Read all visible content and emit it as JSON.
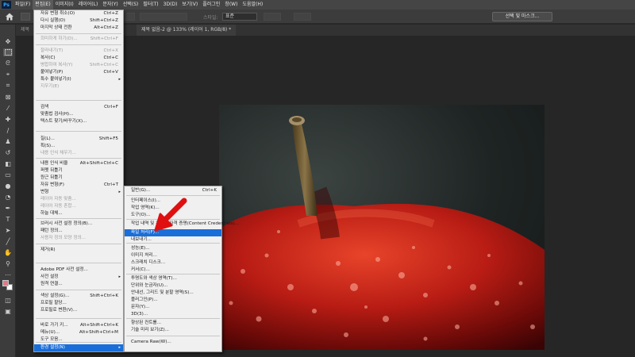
{
  "menubar": {
    "logo": "Ps",
    "items": [
      "파일(F)",
      "편집(E)",
      "이미지(I)",
      "레이어(L)",
      "문자(Y)",
      "선택(S)",
      "필터(T)",
      "3D(D)",
      "보기(V)",
      "플러그인",
      "창(W)",
      "도움말(H)"
    ]
  },
  "options": {
    "style_label": "스타일:",
    "style_value": "표준",
    "mask_button": "선택 및 마스크..."
  },
  "tabs": {
    "doc1": "제목",
    "doc2": "제목 없음-2 @ 133% (레이어 1, RGB/8) *"
  },
  "edit_menu": {
    "items": [
      {
        "label": "자유 변형 취소(O)",
        "shortcut": "Ctrl+Z"
      },
      {
        "label": "다시 실행(O)",
        "shortcut": "Shift+Ctrl+Z"
      },
      {
        "label": "마지막 상태 전환",
        "shortcut": "Alt+Ctrl+Z"
      },
      {
        "label": "희미하게 하기(D)...",
        "shortcut": "Shift+Ctrl+F"
      },
      {
        "label": "잘라내기(T)",
        "shortcut": "Ctrl+X"
      },
      {
        "label": "복사(C)",
        "shortcut": "Ctrl+C"
      },
      {
        "label": "병합하여 복사(Y)",
        "shortcut": "Shift+Ctrl+C"
      },
      {
        "label": "붙여넣기(P)",
        "shortcut": "Ctrl+V"
      },
      {
        "label": "특수 붙여넣기(I)",
        "shortcut": ""
      },
      {
        "label": "지우기(E)",
        "shortcut": ""
      },
      {
        "label": "검색",
        "shortcut": "Ctrl+F"
      },
      {
        "label": "맞춤법 검사(H)...",
        "shortcut": ""
      },
      {
        "label": "텍스트 찾기/바꾸기(X)...",
        "shortcut": ""
      },
      {
        "label": "칠(L)...",
        "shortcut": "Shift+F5"
      },
      {
        "label": "획(S)...",
        "shortcut": ""
      },
      {
        "label": "내용 인식 채우기...",
        "shortcut": ""
      },
      {
        "label": "내용 인식 비율",
        "shortcut": "Alt+Shift+Ctrl+C"
      },
      {
        "label": "퍼펫 뒤틀기",
        "shortcut": ""
      },
      {
        "label": "원근 뒤틀기",
        "shortcut": ""
      },
      {
        "label": "자유 변형(F)",
        "shortcut": "Ctrl+T"
      },
      {
        "label": "변형",
        "shortcut": ""
      },
      {
        "label": "레이어 자동 맞춤...",
        "shortcut": ""
      },
      {
        "label": "레이어 자동 혼합...",
        "shortcut": ""
      },
      {
        "label": "하늘 대체...",
        "shortcut": ""
      },
      {
        "label": "브러시 사전 설정 정의(B)...",
        "shortcut": ""
      },
      {
        "label": "패턴 정의...",
        "shortcut": ""
      },
      {
        "label": "사용자 정의 모양 정의...",
        "shortcut": ""
      },
      {
        "label": "제거(R)",
        "shortcut": ""
      },
      {
        "label": "Adobe PDF 사전 설정...",
        "shortcut": ""
      },
      {
        "label": "사전 설정",
        "shortcut": ""
      },
      {
        "label": "원격 연결...",
        "shortcut": ""
      },
      {
        "label": "색상 설정(G)...",
        "shortcut": "Shift+Ctrl+K"
      },
      {
        "label": "프로필 할당...",
        "shortcut": ""
      },
      {
        "label": "프로필로 변환(V)...",
        "shortcut": ""
      },
      {
        "label": "바로 가기 키...",
        "shortcut": "Alt+Shift+Ctrl+K"
      },
      {
        "label": "메뉴(U)...",
        "shortcut": "Alt+Shift+Ctrl+M"
      },
      {
        "label": "도구 모음...",
        "shortcut": ""
      },
      {
        "label": "환경 설정(N)",
        "shortcut": ""
      }
    ]
  },
  "prefs_menu": {
    "items": [
      {
        "label": "일반(G)...",
        "shortcut": "Ctrl+K"
      },
      {
        "label": "인터페이스(I)...",
        "shortcut": ""
      },
      {
        "label": "작업 영역(K)...",
        "shortcut": ""
      },
      {
        "label": "도구(O)...",
        "shortcut": ""
      },
      {
        "label": "작업 내역 및 콘텐츠 자격 증명(Content Credentials)...",
        "shortcut": ""
      },
      {
        "label": "파일 처리(F)...",
        "shortcut": ""
      },
      {
        "label": "내보내기...",
        "shortcut": ""
      },
      {
        "label": "성능(E)...",
        "shortcut": ""
      },
      {
        "label": "이미지 처리...",
        "shortcut": ""
      },
      {
        "label": "스크래치 디스크...",
        "shortcut": ""
      },
      {
        "label": "커서(C)...",
        "shortcut": ""
      },
      {
        "label": "투명도와 색상 영역(T)...",
        "shortcut": ""
      },
      {
        "label": "단위와 눈금자(U)...",
        "shortcut": ""
      },
      {
        "label": "안내선, 그리드 및 분할 영역(S)...",
        "shortcut": ""
      },
      {
        "label": "플러그인(P)...",
        "shortcut": ""
      },
      {
        "label": "문자(Y)...",
        "shortcut": ""
      },
      {
        "label": "3D(3)...",
        "shortcut": ""
      },
      {
        "label": "향상된 컨트롤...",
        "shortcut": ""
      },
      {
        "label": "기술 미리 보기(Z)...",
        "shortcut": ""
      },
      {
        "label": "Camera Raw(W)...",
        "shortcut": ""
      }
    ]
  },
  "colors": {
    "menu_highlight": "#1a6ed8",
    "annotation_arrow": "#e01010"
  }
}
